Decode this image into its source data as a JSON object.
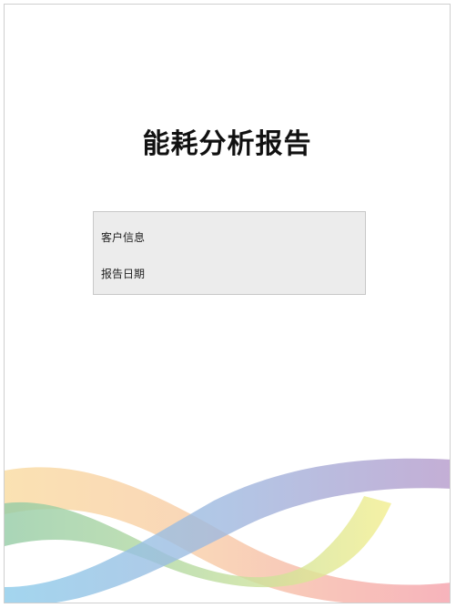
{
  "document": {
    "title": "能耗分析报告",
    "info_fields": [
      {
        "label": "客户信息"
      },
      {
        "label": "报告日期"
      }
    ]
  },
  "decoration": {
    "wave_colors": [
      "#f9d899",
      "#94cba5",
      "#8ccbea",
      "#f3ee8e",
      "#f49aa5",
      "#b59acb"
    ]
  }
}
